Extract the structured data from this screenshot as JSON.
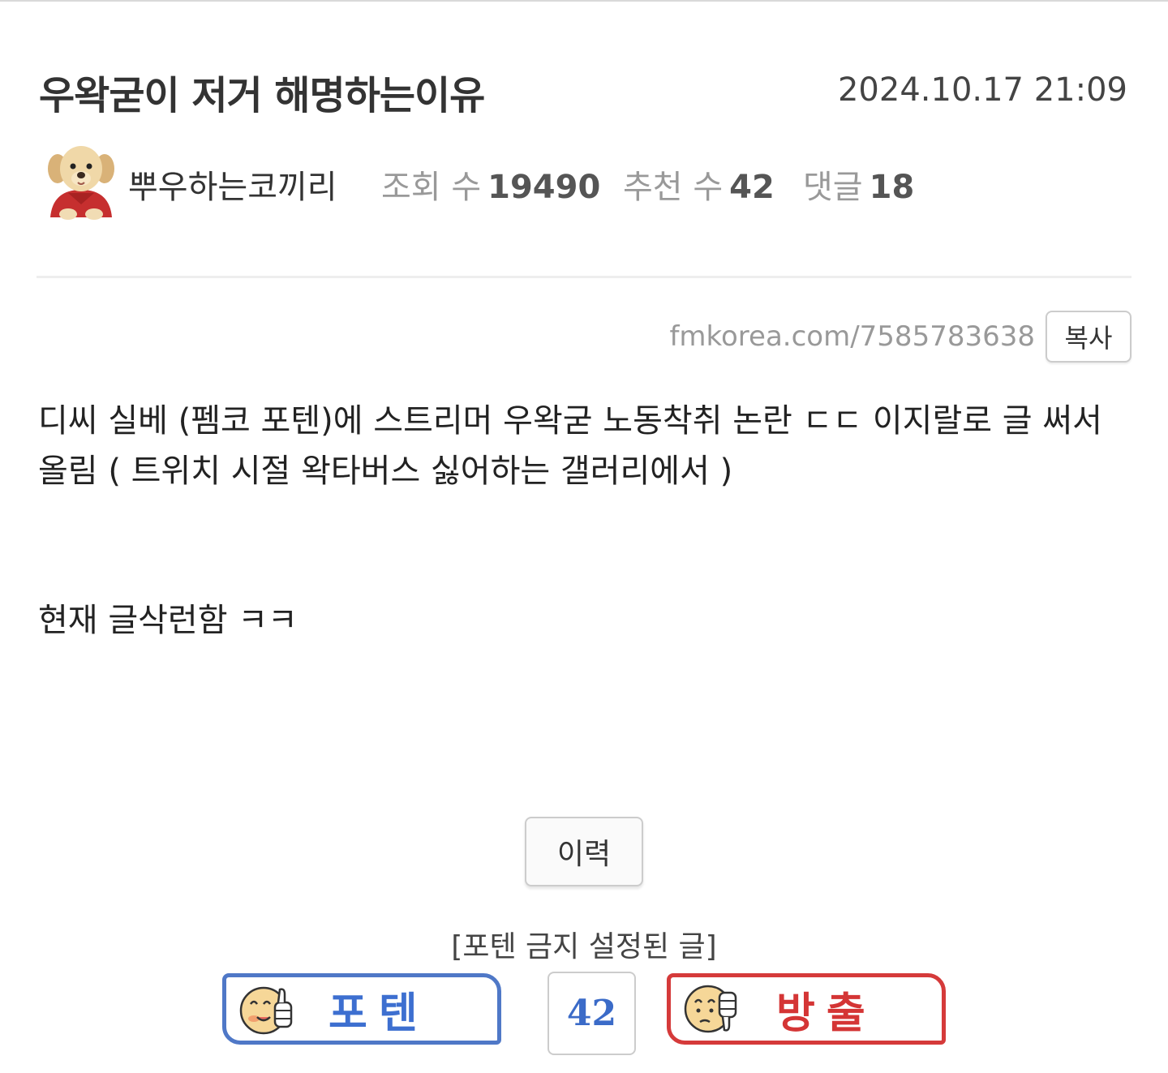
{
  "post": {
    "title": "우왁굳이 저거 해명하는이유",
    "date": "2024.10.17 21:09",
    "author": "뿌우하는코끼리",
    "stats": {
      "views_label": "조회 수",
      "views": "19490",
      "recommend_label": "추천 수",
      "recommend": "42",
      "comments_label": "댓글",
      "comments": "18"
    },
    "url": "fmkorea.com/7585783638",
    "copy_label": "복사",
    "body_line1": "디씨 실베 (펨코 포텐)에 스트리머 우왁굳 노동착취 논란 ㄷㄷ 이지랄로 글 써서 올림 ( 트위치 시절 왁타버스 싫어하는 갤러리에서 )",
    "body_line2": "현재 글삭런함 ㅋㅋ"
  },
  "actions": {
    "history_label": "이력",
    "notice": "[포텐 금지 설정된 글]",
    "upvote_label": "포텐",
    "vote_count": "42",
    "downvote_label": "방출"
  },
  "colors": {
    "upvote_border": "#4f78c7",
    "downvote_border": "#d53a3a"
  },
  "icons": {
    "avatar": "puppy-avatar-icon",
    "upvote": "thumbs-up-face-icon",
    "downvote": "thumbs-down-face-icon"
  }
}
